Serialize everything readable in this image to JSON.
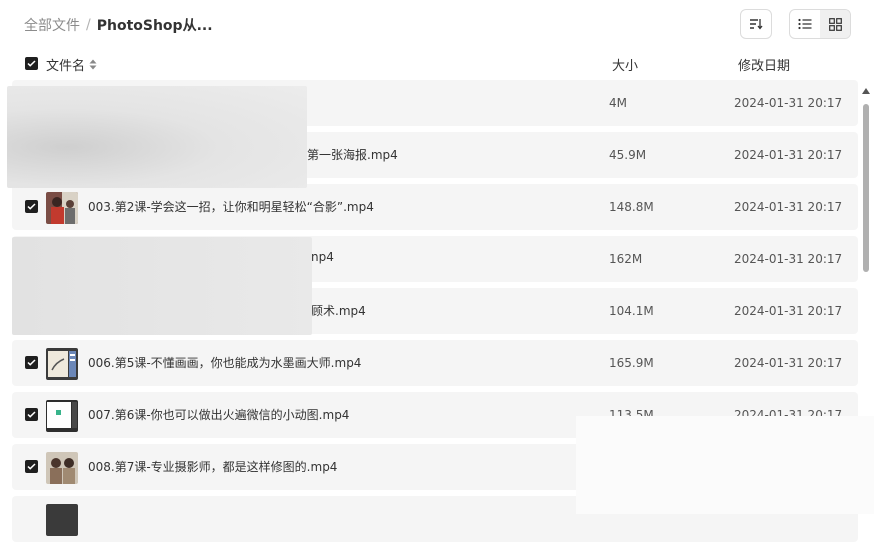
{
  "breadcrumb": {
    "root": "全部文件",
    "separator": "/",
    "current": "PhotoShop从..."
  },
  "columns": {
    "name": "文件名",
    "size": "大小",
    "date": "修改日期"
  },
  "files": [
    {
      "name": "",
      "size": "4M",
      "date": "2024-01-31 20:17"
    },
    {
      "name": "第一张海报.mp4",
      "size": "45.9M",
      "date": "2024-01-31 20:17"
    },
    {
      "name": "003.第2课-学会这一招，让你和明星轻松“合影”.mp4",
      "size": "148.8M",
      "date": "2024-01-31 20:17"
    },
    {
      "name": "np4",
      "size": "162M",
      "date": "2024-01-31 20:17"
    },
    {
      "name": "顾术.mp4",
      "size": "104.1M",
      "date": "2024-01-31 20:17"
    },
    {
      "name": "006.第5课-不懂画画，你也能成为水墨画大师.mp4",
      "size": "165.9M",
      "date": "2024-01-31 20:17"
    },
    {
      "name": "007.第6课-你也可以做出火遍微信的小动图.mp4",
      "size": "113.5M",
      "date": "2024-01-31 20:17"
    },
    {
      "name": "008.第7课-专业摄影师，都是这样修图的.mp4",
      "size": "",
      "date": ""
    },
    {
      "name": "",
      "size": "",
      "date": ""
    }
  ]
}
